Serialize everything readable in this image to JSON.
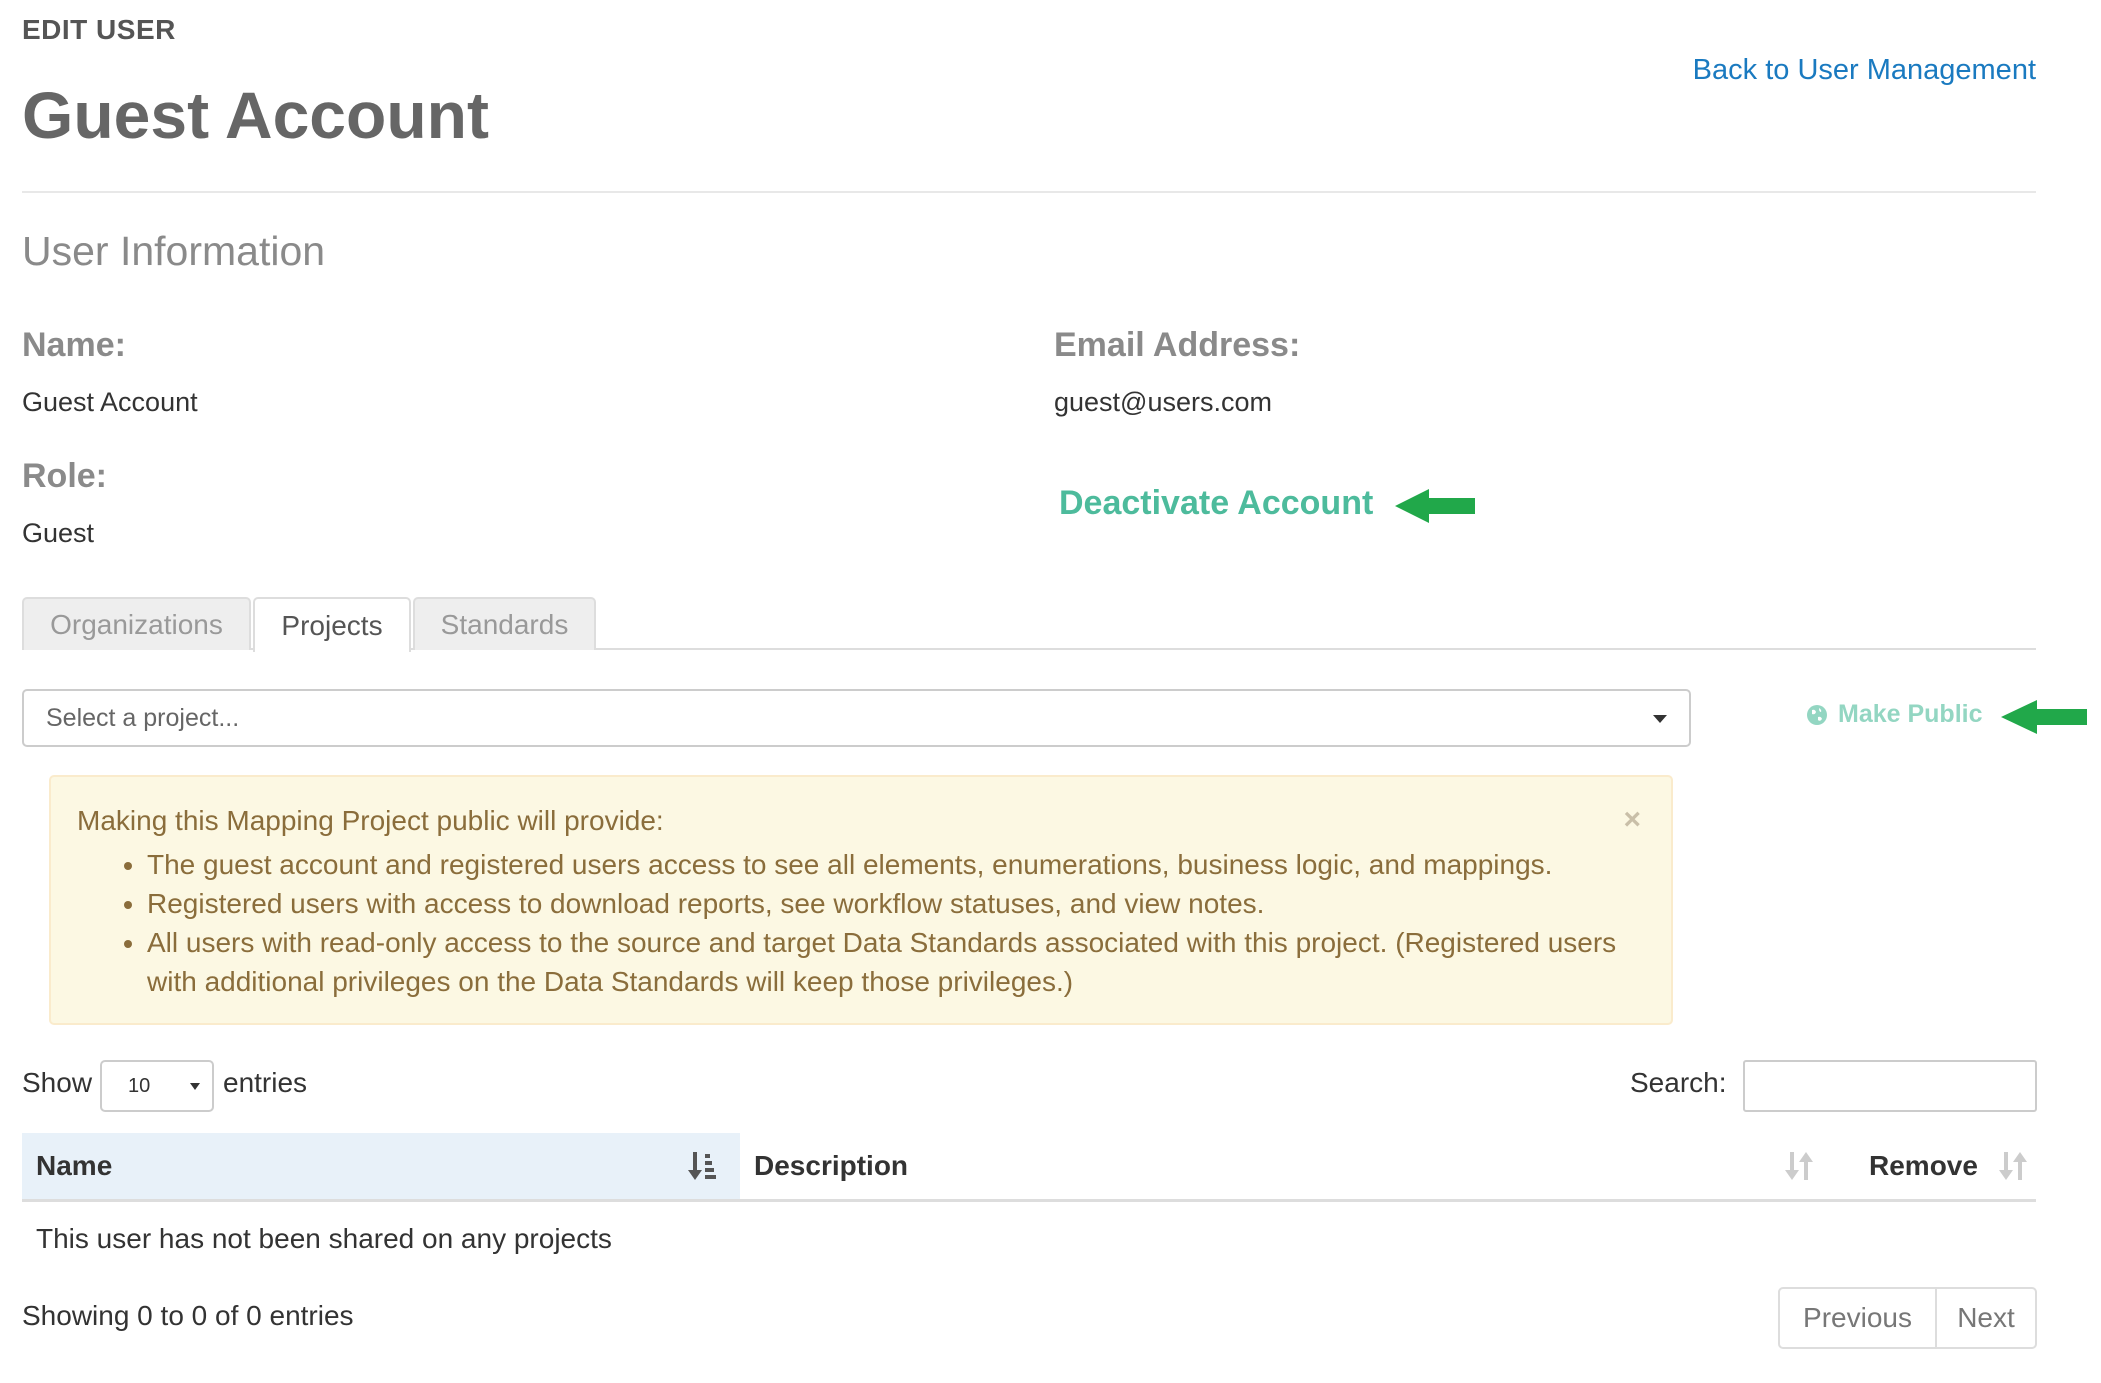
{
  "header": {
    "eyebrow": "EDIT USER",
    "title": "Guest Account",
    "back_link": "Back to User Management"
  },
  "user_info": {
    "heading": "User Information",
    "name_label": "Name:",
    "name_value": "Guest Account",
    "email_label": "Email Address:",
    "email_value": "guest@users.com",
    "role_label": "Role:",
    "role_value": "Guest",
    "deactivate_label": "Deactivate Account"
  },
  "tabs": [
    {
      "label": "Organizations",
      "active": false
    },
    {
      "label": "Projects",
      "active": true
    },
    {
      "label": "Standards",
      "active": false
    }
  ],
  "project_select": {
    "placeholder": "Select a project..."
  },
  "make_public": {
    "label": "Make Public",
    "icon": "globe-icon"
  },
  "alert": {
    "intro": "Making this Mapping Project public will provide:",
    "items": [
      "The guest account and registered users access to see all elements, enumerations, business logic, and mappings.",
      "Registered users with access to download reports, see workflow statuses, and view notes.",
      "All users with read-only access to the source and target Data Standards associated with this project. (Registered users with additional privileges on the Data Standards will keep those privileges.)"
    ],
    "close": "×"
  },
  "table_controls": {
    "show_label": "Show",
    "length_value": "10",
    "entries_label": "entries",
    "search_label": "Search:"
  },
  "table": {
    "columns": [
      "Name",
      "Description",
      "Remove"
    ],
    "empty_message": "This user has not been shared on any projects",
    "info": "Showing 0 to 0 of 0 entries"
  },
  "pagination": {
    "previous": "Previous",
    "next": "Next"
  },
  "colors": {
    "link": "#1a7ac0",
    "accent_teal": "#4dbb9c",
    "annotation_arrow": "#21a84a",
    "alert_bg": "#fcf8e3",
    "alert_text": "#8a6d3b"
  }
}
